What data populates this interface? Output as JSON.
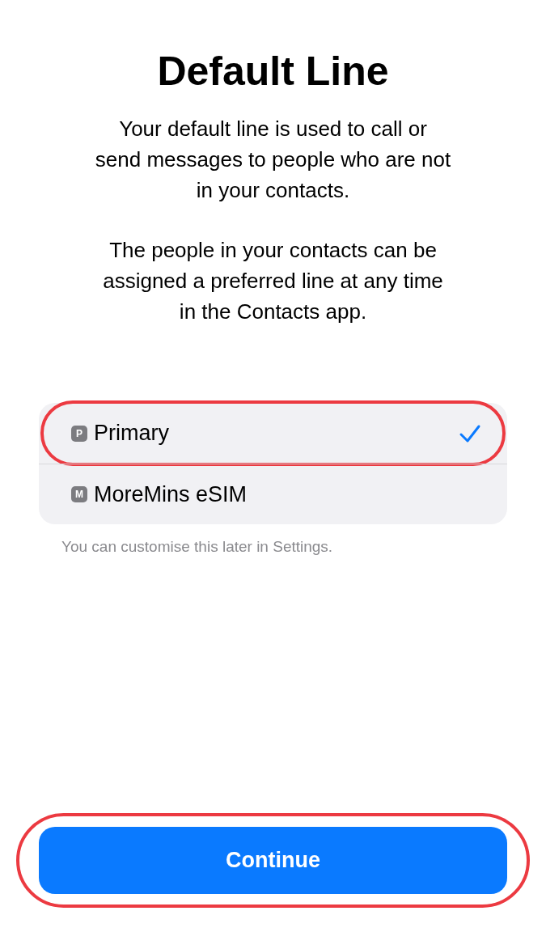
{
  "title": "Default Line",
  "paragraphs": [
    "Your default line is used to call or send messages to people who are not in your contacts.",
    "The people in your contacts can be assigned a preferred line at any time in the Contacts app."
  ],
  "lines": [
    {
      "badge": "P",
      "label": "Primary",
      "selected": true,
      "highlighted": true
    },
    {
      "badge": "M",
      "label": "MoreMins eSIM",
      "selected": false,
      "highlighted": false
    }
  ],
  "footnote": "You can customise this later in Settings.",
  "continue_button": {
    "label": "Continue",
    "highlighted": true
  }
}
